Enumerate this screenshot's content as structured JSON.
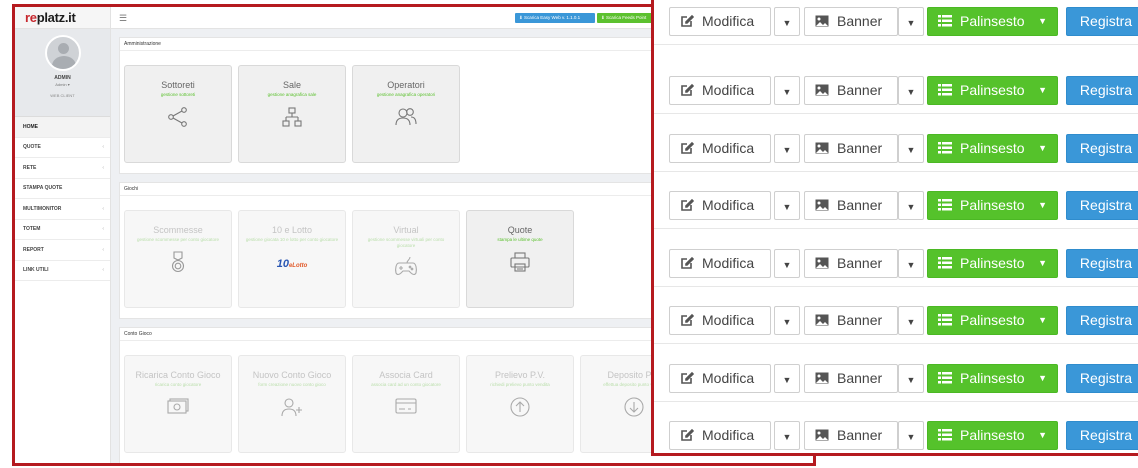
{
  "admin": {
    "logo_prefix": "re",
    "logo_rest": "platz.it",
    "profile": {
      "name": "ADMIN",
      "role": "Admin ▾",
      "client": "WEB CLIENT"
    },
    "nav": [
      {
        "label": "HOME",
        "chevron": ""
      },
      {
        "label": "QUOTE",
        "chevron": "‹"
      },
      {
        "label": "RETE",
        "chevron": "‹"
      },
      {
        "label": "STAMPA QUOTE",
        "chevron": ""
      },
      {
        "label": "MULTIMONITOR",
        "chevron": "‹"
      },
      {
        "label": "TOTEM",
        "chevron": "‹"
      },
      {
        "label": "REPORT",
        "chevron": "‹"
      },
      {
        "label": "LINK UTILI",
        "chevron": "‹"
      }
    ],
    "menu_icon": "☰",
    "top_buttons": {
      "download_web": "⬇ Scarica Easy Web v. 1.1.0.1",
      "download_feeds": "⬇ Scarica Feeds Point"
    },
    "sections": {
      "amministrazione": {
        "title": "Amministrazione",
        "tiles": [
          {
            "name": "Sottoreti",
            "sub": "gestione sottoreti",
            "icon": "share-icon"
          },
          {
            "name": "Sale",
            "sub": "gestione anagrafica sale",
            "icon": "hierarchy-icon"
          },
          {
            "name": "Operatori",
            "sub": "gestione anagrafica operatori",
            "icon": "users-icon"
          }
        ]
      },
      "giochi": {
        "title": "Giochi",
        "tiles": [
          {
            "name": "Scommesse",
            "sub": "gestione scommesse per conto giocatore",
            "icon": "medal-icon"
          },
          {
            "name": "10 e Lotto",
            "sub": "gestione giocata 10 e lotto per conto giocatore",
            "icon": "lotto-logo",
            "logo_main": "10",
            "logo_sub": "eLotto"
          },
          {
            "name": "Virtual",
            "sub": "gestione scommesse virtuali per conto giocatore",
            "icon": "gamepad-icon"
          },
          {
            "name": "Quote",
            "sub": "stampa le ultime quote",
            "icon": "printer-icon"
          }
        ]
      },
      "conto_gioco": {
        "title": "Conto Gioco",
        "tiles": [
          {
            "name": "Ricarica Conto Gioco",
            "sub": "ricarica conto giocatore",
            "icon": "cash-icon"
          },
          {
            "name": "Nuovo Conto Gioco",
            "sub": "form creazione nuovo conto gioco",
            "icon": "add-user-icon"
          },
          {
            "name": "Associa Card",
            "sub": "associa card ad un conto giocatore",
            "icon": "card-icon"
          },
          {
            "name": "Prelievo P.V.",
            "sub": "richiedi prelievo punto vendita",
            "icon": "arrow-up-circle-icon"
          },
          {
            "name": "Deposito P.V.",
            "sub": "effettua deposito punto vendita",
            "icon": "arrow-down-circle-icon"
          }
        ]
      }
    }
  },
  "rows": {
    "labels": {
      "modify": "Modifica",
      "banner": "Banner",
      "schedule": "Palinsesto",
      "register": "Registra"
    },
    "icons": {
      "modify": "edit-icon",
      "banner": "image-icon",
      "schedule": "list-icon",
      "dropdown": "caret-down-icon"
    },
    "colors": {
      "schedule": "#55c22b",
      "register": "#3a97d8"
    }
  }
}
